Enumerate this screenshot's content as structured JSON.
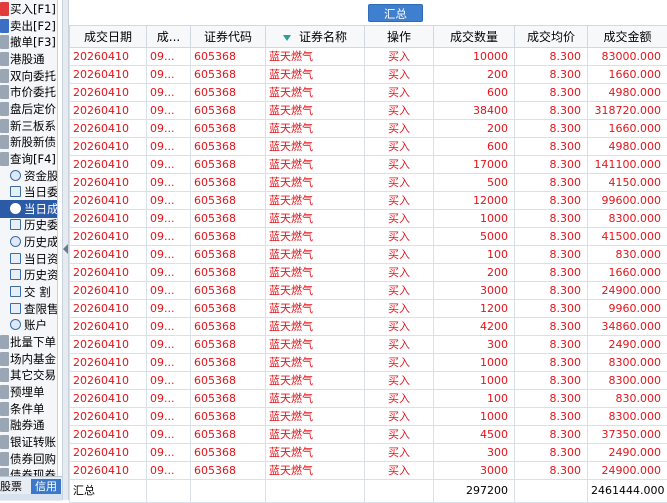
{
  "sidebar": {
    "items": [
      {
        "label": "买入[F1]",
        "lead": "red",
        "indent": false
      },
      {
        "label": "卖出[F2]",
        "lead": "blue",
        "indent": false
      },
      {
        "label": "撤单[F3]",
        "lead": "gray",
        "indent": false
      },
      {
        "label": "港股通",
        "lead": "gray",
        "indent": false
      },
      {
        "label": "双向委托",
        "lead": "gray",
        "indent": false
      },
      {
        "label": "市价委托",
        "lead": "gray",
        "indent": false
      },
      {
        "label": "盘后定价",
        "lead": "gray",
        "indent": false
      },
      {
        "label": "新三板系",
        "lead": "gray",
        "indent": false
      },
      {
        "label": "新股新债",
        "lead": "gray",
        "indent": false
      },
      {
        "label": "查询[F4]",
        "lead": "gray",
        "indent": false
      },
      {
        "label": "资金股",
        "lead": "",
        "indent": true,
        "icon": "round"
      },
      {
        "label": "当日委",
        "lead": "",
        "indent": true,
        "icon": "square"
      },
      {
        "label": "当日成",
        "lead": "",
        "indent": true,
        "icon": "round",
        "selected": true
      },
      {
        "label": "历史委",
        "lead": "",
        "indent": true,
        "icon": "square"
      },
      {
        "label": "历史成",
        "lead": "",
        "indent": true,
        "icon": "round"
      },
      {
        "label": "当日资",
        "lead": "",
        "indent": true,
        "icon": "square"
      },
      {
        "label": "历史资",
        "lead": "",
        "indent": true,
        "icon": "square"
      },
      {
        "label": "交 割",
        "lead": "",
        "indent": true,
        "icon": "square"
      },
      {
        "label": "查限售",
        "lead": "",
        "indent": true,
        "icon": "square"
      },
      {
        "label": "账户",
        "lead": "",
        "indent": true,
        "icon": "round"
      },
      {
        "label": "批量下单",
        "lead": "gray",
        "indent": false
      },
      {
        "label": "场内基金",
        "lead": "gray",
        "indent": false
      },
      {
        "label": "其它交易",
        "lead": "gray",
        "indent": false
      },
      {
        "label": "预埋单",
        "lead": "gray",
        "indent": false
      },
      {
        "label": "条件单",
        "lead": "gray",
        "indent": false
      },
      {
        "label": "融券通",
        "lead": "gray",
        "indent": false
      },
      {
        "label": "银证转账",
        "lead": "gray",
        "indent": false
      },
      {
        "label": "债券回购",
        "lead": "gray",
        "indent": false
      },
      {
        "label": "债券现券",
        "lead": "gray",
        "indent": false
      },
      {
        "label": "上海债券",
        "lead": "gray",
        "indent": false
      }
    ],
    "tabs": {
      "stock": "股票",
      "credit": "信用"
    }
  },
  "toolbar": {
    "summary_label": "汇总"
  },
  "table": {
    "headers": [
      "成交日期",
      "成...",
      "证券代码",
      "证券名称",
      "操作",
      "成交数量",
      "成交均价",
      "成交金额"
    ],
    "rows": [
      [
        "20260410",
        "09...",
        "605368",
        "蓝天燃气",
        "买入",
        "10000",
        "8.300",
        "83000.000"
      ],
      [
        "20260410",
        "09...",
        "605368",
        "蓝天燃气",
        "买入",
        "200",
        "8.300",
        "1660.000"
      ],
      [
        "20260410",
        "09...",
        "605368",
        "蓝天燃气",
        "买入",
        "600",
        "8.300",
        "4980.000"
      ],
      [
        "20260410",
        "09...",
        "605368",
        "蓝天燃气",
        "买入",
        "38400",
        "8.300",
        "318720.000"
      ],
      [
        "20260410",
        "09...",
        "605368",
        "蓝天燃气",
        "买入",
        "200",
        "8.300",
        "1660.000"
      ],
      [
        "20260410",
        "09...",
        "605368",
        "蓝天燃气",
        "买入",
        "600",
        "8.300",
        "4980.000"
      ],
      [
        "20260410",
        "09...",
        "605368",
        "蓝天燃气",
        "买入",
        "17000",
        "8.300",
        "141100.000"
      ],
      [
        "20260410",
        "09...",
        "605368",
        "蓝天燃气",
        "买入",
        "500",
        "8.300",
        "4150.000"
      ],
      [
        "20260410",
        "09...",
        "605368",
        "蓝天燃气",
        "买入",
        "12000",
        "8.300",
        "99600.000"
      ],
      [
        "20260410",
        "09...",
        "605368",
        "蓝天燃气",
        "买入",
        "1000",
        "8.300",
        "8300.000"
      ],
      [
        "20260410",
        "09...",
        "605368",
        "蓝天燃气",
        "买入",
        "5000",
        "8.300",
        "41500.000"
      ],
      [
        "20260410",
        "09...",
        "605368",
        "蓝天燃气",
        "买入",
        "100",
        "8.300",
        "830.000"
      ],
      [
        "20260410",
        "09...",
        "605368",
        "蓝天燃气",
        "买入",
        "200",
        "8.300",
        "1660.000"
      ],
      [
        "20260410",
        "09...",
        "605368",
        "蓝天燃气",
        "买入",
        "3000",
        "8.300",
        "24900.000"
      ],
      [
        "20260410",
        "09...",
        "605368",
        "蓝天燃气",
        "买入",
        "1200",
        "8.300",
        "9960.000"
      ],
      [
        "20260410",
        "09...",
        "605368",
        "蓝天燃气",
        "买入",
        "4200",
        "8.300",
        "34860.000"
      ],
      [
        "20260410",
        "09...",
        "605368",
        "蓝天燃气",
        "买入",
        "300",
        "8.300",
        "2490.000"
      ],
      [
        "20260410",
        "09...",
        "605368",
        "蓝天燃气",
        "买入",
        "1000",
        "8.300",
        "8300.000"
      ],
      [
        "20260410",
        "09...",
        "605368",
        "蓝天燃气",
        "买入",
        "1000",
        "8.300",
        "8300.000"
      ],
      [
        "20260410",
        "09...",
        "605368",
        "蓝天燃气",
        "买入",
        "100",
        "8.300",
        "830.000"
      ],
      [
        "20260410",
        "09...",
        "605368",
        "蓝天燃气",
        "买入",
        "1000",
        "8.300",
        "8300.000"
      ],
      [
        "20260410",
        "09...",
        "605368",
        "蓝天燃气",
        "买入",
        "4500",
        "8.300",
        "37350.000"
      ],
      [
        "20260410",
        "09...",
        "605368",
        "蓝天燃气",
        "买入",
        "300",
        "8.300",
        "2490.000"
      ],
      [
        "20260410",
        "09...",
        "605368",
        "蓝天燃气",
        "买入",
        "3000",
        "8.300",
        "24900.000"
      ]
    ],
    "total": {
      "label": "汇总",
      "quantity": "297200",
      "amount": "2461444.000"
    }
  },
  "colors": {
    "text_red": "#e4141b",
    "selected_bg": "#2b5aa7",
    "button_blue": "#3f7fcf"
  }
}
